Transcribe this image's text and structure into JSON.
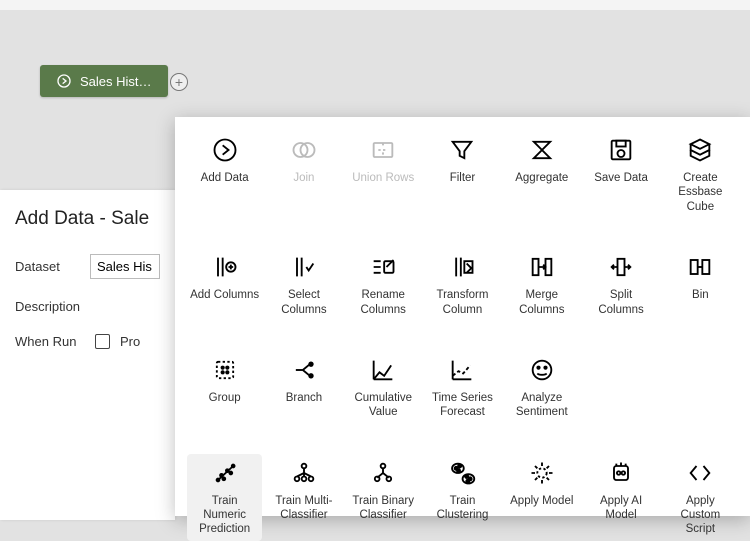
{
  "chip": {
    "label": "Sales Hist…"
  },
  "panel": {
    "title": "Add Data - Sale",
    "dataset_label": "Dataset",
    "dataset_value": "Sales His",
    "description_label": "Description",
    "whenrun_label": "When Run",
    "whenrun_option": "Pro"
  },
  "tools": {
    "r0": [
      {
        "k": "add-data",
        "label": "Add Data",
        "dis": false
      },
      {
        "k": "join",
        "label": "Join",
        "dis": true
      },
      {
        "k": "union",
        "label": "Union Rows",
        "dis": true
      },
      {
        "k": "filter",
        "label": "Filter",
        "dis": false
      },
      {
        "k": "aggregate",
        "label": "Aggregate",
        "dis": false
      },
      {
        "k": "save-data",
        "label": "Save Data",
        "dis": false
      },
      {
        "k": "essbase",
        "label": "Create Essbase Cube",
        "dis": false
      }
    ],
    "r1": [
      {
        "k": "add-cols",
        "label": "Add Columns",
        "dis": false
      },
      {
        "k": "select-cols",
        "label": "Select Columns",
        "dis": false
      },
      {
        "k": "rename-cols",
        "label": "Rename Columns",
        "dis": false
      },
      {
        "k": "transform",
        "label": "Transform Column",
        "dis": false
      },
      {
        "k": "merge-cols",
        "label": "Merge Columns",
        "dis": false
      },
      {
        "k": "split-cols",
        "label": "Split Columns",
        "dis": false
      },
      {
        "k": "bin",
        "label": "Bin",
        "dis": false
      }
    ],
    "r2": [
      {
        "k": "group",
        "label": "Group",
        "dis": false
      },
      {
        "k": "branch",
        "label": "Branch",
        "dis": false
      },
      {
        "k": "cumulative",
        "label": "Cumulative Value",
        "dis": false
      },
      {
        "k": "timeseries",
        "label": "Time Series Forecast",
        "dis": false
      },
      {
        "k": "sentiment",
        "label": "Analyze Sentiment",
        "dis": false
      }
    ],
    "r3": [
      {
        "k": "train-num",
        "label": "Train Numeric Prediction",
        "dis": false,
        "hover": true
      },
      {
        "k": "train-multi",
        "label": "Train Multi-Classifier",
        "dis": false
      },
      {
        "k": "train-bin",
        "label": "Train Binary Classifier",
        "dis": false
      },
      {
        "k": "train-clust",
        "label": "Train Clustering",
        "dis": false
      },
      {
        "k": "apply-model",
        "label": "Apply Model",
        "dis": false
      },
      {
        "k": "apply-ai",
        "label": "Apply AI Model",
        "dis": false
      },
      {
        "k": "apply-script",
        "label": "Apply Custom Script",
        "dis": false
      }
    ]
  }
}
